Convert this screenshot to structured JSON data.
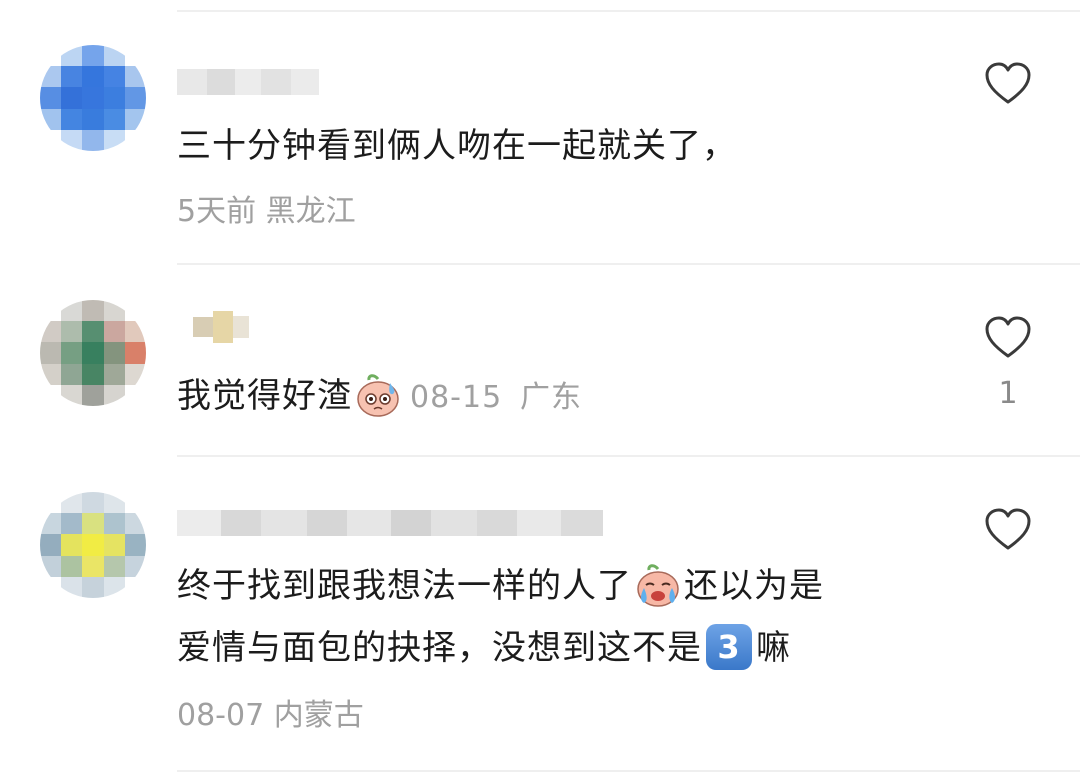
{
  "comments": [
    {
      "text": "三十分钟看到俩人吻在一起就关了，",
      "time": "5天前",
      "location": "黑龙江",
      "likes": "",
      "avatar_icon": "blurred-avatar-blue"
    },
    {
      "text": "我觉得好渣",
      "emoji_icon": "sweating-face-emoji",
      "time": "08-15",
      "location": "广东",
      "likes": "1",
      "avatar_icon": "blurred-avatar-green"
    },
    {
      "text_line1_a": "终于找到跟我想法一样的人了",
      "emoji_icon": "crying-face-emoji",
      "text_line1_b": "还以为是",
      "text_line2_a": "爱情与面包的抉择，没想到这不是",
      "badge": "3",
      "text_line2_b": "嘛",
      "time": "08-07",
      "location": "内蒙古",
      "likes": "",
      "avatar_icon": "blurred-avatar-yellow"
    }
  ],
  "colors": {
    "meta_gray": "#a0a0a0",
    "divider": "#efefef",
    "text": "#1c1c1c",
    "heart_stroke": "#3a3a3a"
  }
}
